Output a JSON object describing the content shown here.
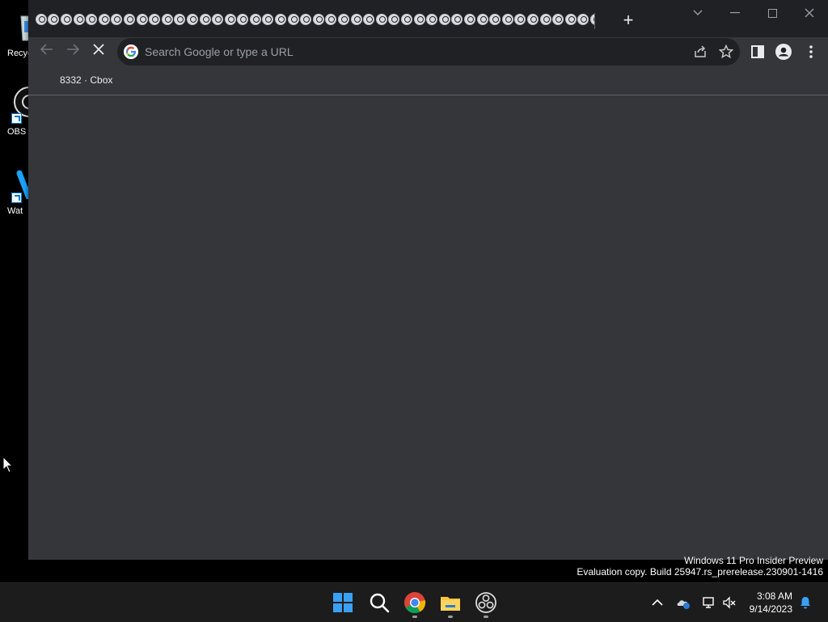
{
  "desktop": {
    "icons": [
      {
        "name": "recycle-bin",
        "label": "Recyc"
      },
      {
        "name": "obs-studio",
        "label": "OBS S"
      },
      {
        "name": "wat",
        "label": "Wat"
      }
    ]
  },
  "browser": {
    "tabs": {
      "count": 46,
      "favicon": "skull-favicon"
    },
    "new_tab_label": "+",
    "omnibox_placeholder": "Search Google or type a URL",
    "bookmark": "8332 · Cbox",
    "accent": "#35363a",
    "frame": "#202124"
  },
  "watermark": {
    "line1": "Windows 11 Pro Insider Preview",
    "line2": "Evaluation copy. Build 25947.rs_prerelease.230901-1416"
  },
  "taskbar": {
    "apps": [
      "start-icon",
      "search-icon",
      "chrome-icon",
      "file-explorer-icon",
      "obs-icon"
    ],
    "clock": {
      "time": "3:08 AM",
      "date": "9/14/2023"
    }
  }
}
